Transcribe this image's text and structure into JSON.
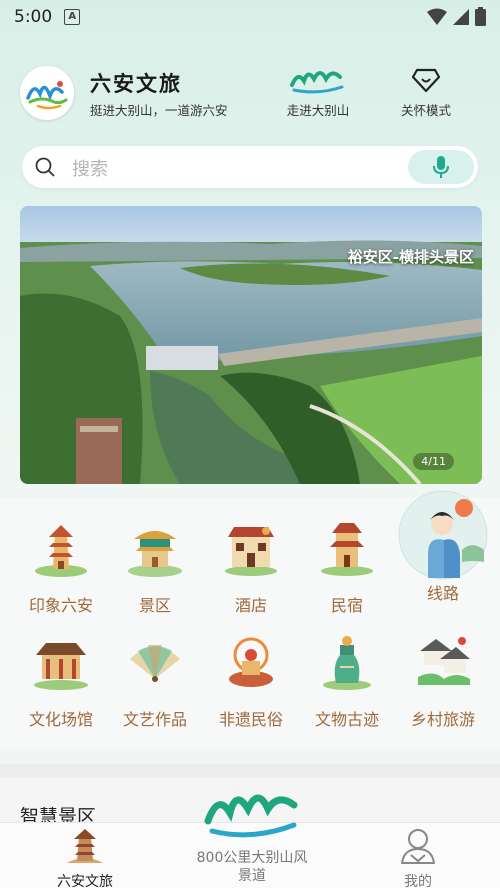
{
  "status": {
    "time": "5:00",
    "notif": "A"
  },
  "header": {
    "brand_title": "六安文旅",
    "slogan": "挺进大别山，一道游六安",
    "links": [
      {
        "label": "走进大别山",
        "icon": "dabieshan-logo-icon"
      },
      {
        "label": "关怀模式",
        "icon": "diamond-care-icon"
      }
    ]
  },
  "search": {
    "placeholder": "搜索"
  },
  "banner": {
    "caption": "裕安区-横排头景区",
    "counter": "4/11"
  },
  "grid": [
    {
      "label": "印象六安",
      "icon": "pagoda-icon"
    },
    {
      "label": "景区",
      "icon": "pavilion-icon"
    },
    {
      "label": "酒店",
      "icon": "hotel-icon"
    },
    {
      "label": "民宿",
      "icon": "homestay-icon"
    },
    {
      "label": "线路",
      "icon": "guide-avatar-icon"
    },
    {
      "label": "文化场馆",
      "icon": "museum-icon"
    },
    {
      "label": "文艺作品",
      "icon": "fan-icon"
    },
    {
      "label": "非遗民俗",
      "icon": "folk-icon"
    },
    {
      "label": "文物古迹",
      "icon": "relic-icon"
    },
    {
      "label": "乡村旅游",
      "icon": "village-icon"
    }
  ],
  "section": {
    "title": "智慧景区"
  },
  "tabbar": {
    "home": "六安文旅",
    "center": "800公里大别山风景道",
    "me": "我的"
  },
  "colors": {
    "accent": "#2bb39b",
    "label_brown": "#a0693c",
    "mic": "#1eaa8c"
  }
}
